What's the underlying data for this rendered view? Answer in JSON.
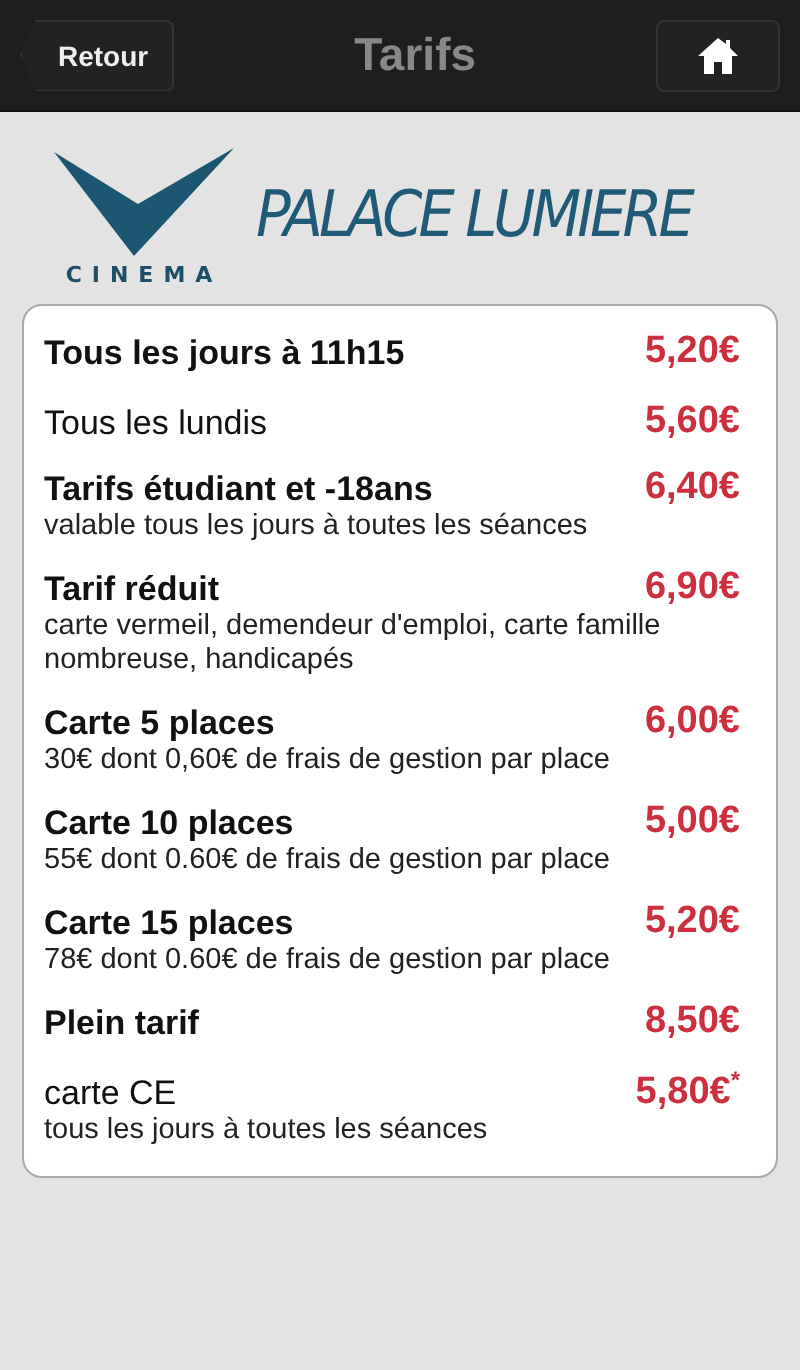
{
  "header": {
    "back": "Retour",
    "title": "Tarifs"
  },
  "logo": {
    "tagline": "CINEMA",
    "name": "PALACE LUMIERE"
  },
  "rates": [
    {
      "kind": "bold",
      "label": "Tous les jours à 11h15",
      "price": "5,20€"
    },
    {
      "kind": "plain",
      "label": "Tous les lundis",
      "price": "5,60€"
    },
    {
      "kind": "bold",
      "label": "Tarifs étudiant et -18ans",
      "price": "6,40€",
      "note": "valable tous les jours à toutes les séances"
    },
    {
      "kind": "bold",
      "label": "Tarif réduit",
      "price": "6,90€",
      "note": "carte vermeil, demendeur d'emploi, carte famille nombreuse, handicapés"
    },
    {
      "kind": "bold",
      "label": "Carte 5 places",
      "price": "6,00€",
      "note": "30€ dont 0,60€ de frais de gestion par place"
    },
    {
      "kind": "bold",
      "label": "Carte 10 places",
      "price": "5,00€",
      "note": "55€ dont 0.60€ de frais de gestion par place"
    },
    {
      "kind": "bold",
      "label": "Carte 15 places",
      "price": "5,20€",
      "note": "78€ dont 0.60€ de frais de gestion par place"
    },
    {
      "kind": "bold",
      "label": "Plein tarif",
      "price": "8,50€"
    },
    {
      "kind": "plain",
      "label": "carte CE",
      "price": "5,80€$^{*}$",
      "note": "tous les jours à toutes les séances"
    }
  ]
}
